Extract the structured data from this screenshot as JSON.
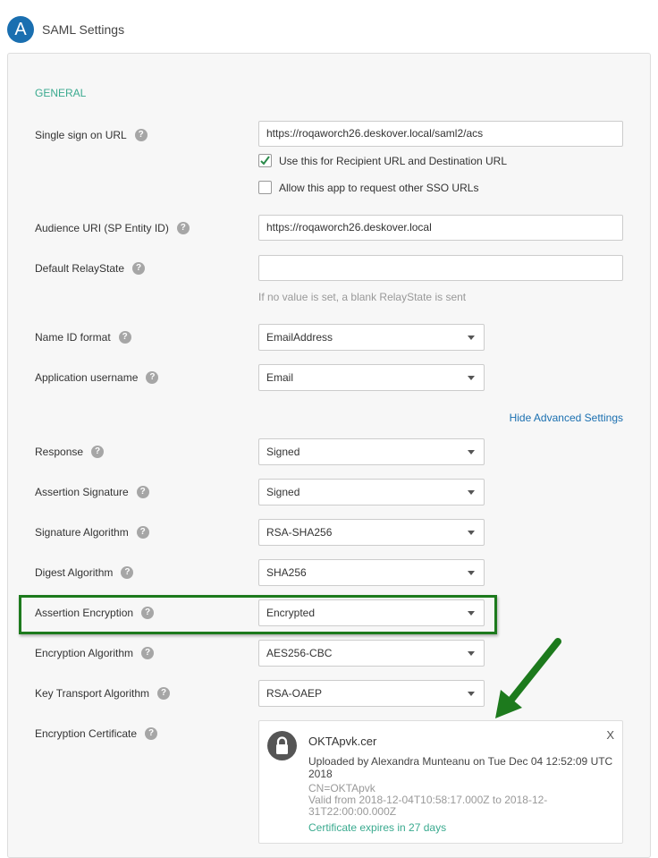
{
  "header": {
    "avatar_letter": "A",
    "title": "SAML Settings"
  },
  "section": "GENERAL",
  "fields": {
    "sso_url": {
      "label": "Single sign on URL",
      "value": "https://roqaworch26.deskover.local/saml2/acs"
    },
    "recipient_check": {
      "label": "Use this for Recipient URL and Destination URL",
      "checked": true
    },
    "other_sso_check": {
      "label": "Allow this app to request other SSO URLs",
      "checked": false
    },
    "audience": {
      "label": "Audience URI (SP Entity ID)",
      "value": "https://roqaworch26.deskover.local"
    },
    "relay": {
      "label": "Default RelayState",
      "value": "",
      "hint": "If no value is set, a blank RelayState is sent"
    },
    "nameid": {
      "label": "Name ID format",
      "value": "EmailAddress"
    },
    "username": {
      "label": "Application username",
      "value": "Email"
    },
    "advanced_link": "Hide Advanced Settings",
    "response": {
      "label": "Response",
      "value": "Signed"
    },
    "assertion_sig": {
      "label": "Assertion Signature",
      "value": "Signed"
    },
    "sig_alg": {
      "label": "Signature Algorithm",
      "value": "RSA-SHA256"
    },
    "digest": {
      "label": "Digest Algorithm",
      "value": "SHA256"
    },
    "assertion_enc": {
      "label": "Assertion Encryption",
      "value": "Encrypted"
    },
    "enc_alg": {
      "label": "Encryption Algorithm",
      "value": "AES256-CBC"
    },
    "key_transport": {
      "label": "Key Transport Algorithm",
      "value": "RSA-OAEP"
    },
    "enc_cert": {
      "label": "Encryption Certificate"
    }
  },
  "certificate": {
    "name": "OKTApvk.cer",
    "uploaded": "Uploaded by Alexandra Munteanu on Tue Dec 04 12:52:09 UTC 2018",
    "cn": "CN=OKTApvk",
    "valid": "Valid from 2018-12-04T10:58:17.000Z to 2018-12-31T22:00:00.000Z",
    "expires": "Certificate expires in 27 days",
    "close": "X"
  },
  "colors": {
    "accent": "#1a6fb0",
    "section": "#3aaa8f",
    "highlight": "#1d7a1d"
  }
}
